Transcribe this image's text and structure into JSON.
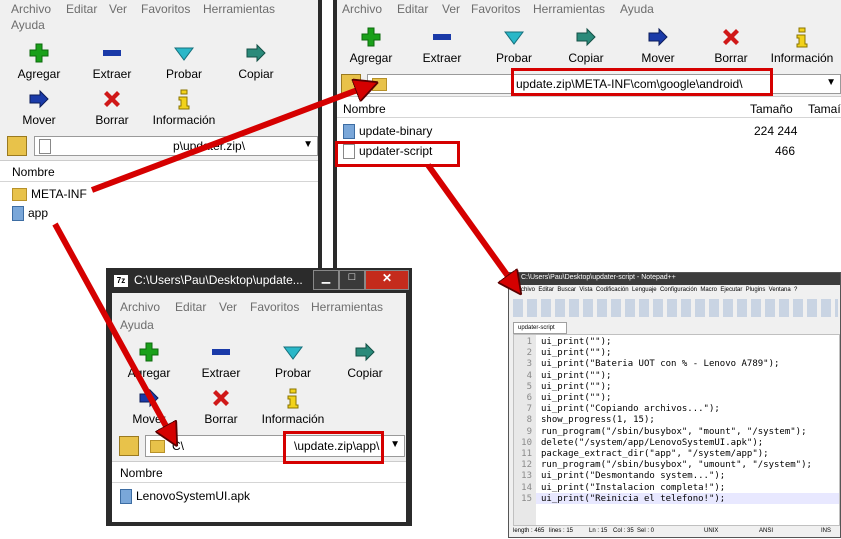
{
  "menu": {
    "archivo": "Archivo",
    "editar": "Editar",
    "ver": "Ver",
    "favoritos": "Favoritos",
    "herramientas": "Herramientas",
    "ayuda": "Ayuda"
  },
  "toolbar": {
    "agregar": "Agregar",
    "extraer": "Extraer",
    "probar": "Probar",
    "copiar": "Copiar",
    "mover": "Mover",
    "borrar": "Borrar",
    "informacion": "Información"
  },
  "left_window": {
    "address": "p\\updater.zip\\",
    "column_name": "Nombre",
    "items": [
      "META-INF",
      "app"
    ]
  },
  "right_window": {
    "address": "update.zip\\META-INF\\com\\google\\android\\",
    "column_name": "Nombre",
    "column_size": "Tamaño",
    "column_size2": "Tamaí",
    "files": [
      {
        "name": "update-binary",
        "size": "224 244"
      },
      {
        "name": "updater-script",
        "size": "466"
      }
    ]
  },
  "center_window": {
    "title": "C:\\Users\\Pau\\Desktop\\update...",
    "app_icon": "7z",
    "address_short": "C\\",
    "address": "\\update.zip\\app\\",
    "column_name": "Nombre",
    "files": [
      "LenovoSystemUI.apk"
    ]
  },
  "notepad": {
    "title": "C:\\Users\\Pau\\Desktop\\updater-script - Notepad++",
    "menu": "Archivo  Editar  Buscar  Vista  Codificación  Lenguaje  Configuración  Macro  Ejecutar  Plugins  Ventana  ?",
    "tab": "updater-script",
    "lines": [
      "ui_print(\"\");",
      "ui_print(\"\");",
      "ui_print(\"Bateria UOT con % - Lenovo A789\");",
      "ui_print(\"\");",
      "ui_print(\"\");",
      "ui_print(\"\");",
      "ui_print(\"Copiando archivos...\");",
      "show_progress(1, 15);",
      "run_program(\"/sbin/busybox\", \"mount\", \"/system\");",
      "delete(\"/system/app/LenovoSystemUI.apk\");",
      "package_extract_dir(\"app\", \"/system/app\");",
      "run_program(\"/sbin/busybox\", \"umount\", \"/system\");",
      "ui_print(\"Desmontando system...\");",
      "ui_print(\"Instalacion completa!\");",
      "ui_print(\"Reinicia el telefono!\");"
    ],
    "status": {
      "length": "length : 465",
      "lines": "lines : 15",
      "ln": "Ln : 15",
      "col": "Col : 35",
      "sel": "Sel : 0",
      "eol": "UNIX",
      "enc": "ANSI",
      "mode": "INS"
    }
  },
  "colors": {
    "highlight": "#d50000",
    "window_bg": "#f0f0f0",
    "add_green": "#1aa01a",
    "extract_blue": "#1a3aa8",
    "test_cyan": "#2ab7c8",
    "copy_teal": "#2a8a7a",
    "delete_red": "#d01818",
    "info_yellow": "#f2d21a"
  }
}
